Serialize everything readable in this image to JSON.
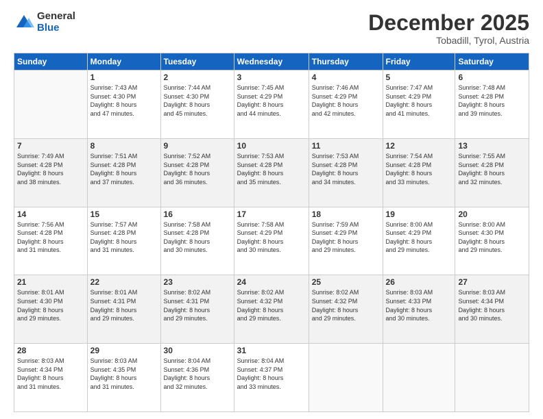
{
  "logo": {
    "general": "General",
    "blue": "Blue"
  },
  "header": {
    "month": "December 2025",
    "location": "Tobadill, Tyrol, Austria"
  },
  "weekdays": [
    "Sunday",
    "Monday",
    "Tuesday",
    "Wednesday",
    "Thursday",
    "Friday",
    "Saturday"
  ],
  "weeks": [
    [
      {
        "day": "",
        "sunrise": "",
        "sunset": "",
        "daylight": ""
      },
      {
        "day": "1",
        "sunrise": "Sunrise: 7:43 AM",
        "sunset": "Sunset: 4:30 PM",
        "daylight": "Daylight: 8 hours and 47 minutes."
      },
      {
        "day": "2",
        "sunrise": "Sunrise: 7:44 AM",
        "sunset": "Sunset: 4:30 PM",
        "daylight": "Daylight: 8 hours and 45 minutes."
      },
      {
        "day": "3",
        "sunrise": "Sunrise: 7:45 AM",
        "sunset": "Sunset: 4:29 PM",
        "daylight": "Daylight: 8 hours and 44 minutes."
      },
      {
        "day": "4",
        "sunrise": "Sunrise: 7:46 AM",
        "sunset": "Sunset: 4:29 PM",
        "daylight": "Daylight: 8 hours and 42 minutes."
      },
      {
        "day": "5",
        "sunrise": "Sunrise: 7:47 AM",
        "sunset": "Sunset: 4:29 PM",
        "daylight": "Daylight: 8 hours and 41 minutes."
      },
      {
        "day": "6",
        "sunrise": "Sunrise: 7:48 AM",
        "sunset": "Sunset: 4:28 PM",
        "daylight": "Daylight: 8 hours and 39 minutes."
      }
    ],
    [
      {
        "day": "7",
        "sunrise": "Sunrise: 7:49 AM",
        "sunset": "Sunset: 4:28 PM",
        "daylight": "Daylight: 8 hours and 38 minutes."
      },
      {
        "day": "8",
        "sunrise": "Sunrise: 7:51 AM",
        "sunset": "Sunset: 4:28 PM",
        "daylight": "Daylight: 8 hours and 37 minutes."
      },
      {
        "day": "9",
        "sunrise": "Sunrise: 7:52 AM",
        "sunset": "Sunset: 4:28 PM",
        "daylight": "Daylight: 8 hours and 36 minutes."
      },
      {
        "day": "10",
        "sunrise": "Sunrise: 7:53 AM",
        "sunset": "Sunset: 4:28 PM",
        "daylight": "Daylight: 8 hours and 35 minutes."
      },
      {
        "day": "11",
        "sunrise": "Sunrise: 7:53 AM",
        "sunset": "Sunset: 4:28 PM",
        "daylight": "Daylight: 8 hours and 34 minutes."
      },
      {
        "day": "12",
        "sunrise": "Sunrise: 7:54 AM",
        "sunset": "Sunset: 4:28 PM",
        "daylight": "Daylight: 8 hours and 33 minutes."
      },
      {
        "day": "13",
        "sunrise": "Sunrise: 7:55 AM",
        "sunset": "Sunset: 4:28 PM",
        "daylight": "Daylight: 8 hours and 32 minutes."
      }
    ],
    [
      {
        "day": "14",
        "sunrise": "Sunrise: 7:56 AM",
        "sunset": "Sunset: 4:28 PM",
        "daylight": "Daylight: 8 hours and 31 minutes."
      },
      {
        "day": "15",
        "sunrise": "Sunrise: 7:57 AM",
        "sunset": "Sunset: 4:28 PM",
        "daylight": "Daylight: 8 hours and 31 minutes."
      },
      {
        "day": "16",
        "sunrise": "Sunrise: 7:58 AM",
        "sunset": "Sunset: 4:28 PM",
        "daylight": "Daylight: 8 hours and 30 minutes."
      },
      {
        "day": "17",
        "sunrise": "Sunrise: 7:58 AM",
        "sunset": "Sunset: 4:29 PM",
        "daylight": "Daylight: 8 hours and 30 minutes."
      },
      {
        "day": "18",
        "sunrise": "Sunrise: 7:59 AM",
        "sunset": "Sunset: 4:29 PM",
        "daylight": "Daylight: 8 hours and 29 minutes."
      },
      {
        "day": "19",
        "sunrise": "Sunrise: 8:00 AM",
        "sunset": "Sunset: 4:29 PM",
        "daylight": "Daylight: 8 hours and 29 minutes."
      },
      {
        "day": "20",
        "sunrise": "Sunrise: 8:00 AM",
        "sunset": "Sunset: 4:30 PM",
        "daylight": "Daylight: 8 hours and 29 minutes."
      }
    ],
    [
      {
        "day": "21",
        "sunrise": "Sunrise: 8:01 AM",
        "sunset": "Sunset: 4:30 PM",
        "daylight": "Daylight: 8 hours and 29 minutes."
      },
      {
        "day": "22",
        "sunrise": "Sunrise: 8:01 AM",
        "sunset": "Sunset: 4:31 PM",
        "daylight": "Daylight: 8 hours and 29 minutes."
      },
      {
        "day": "23",
        "sunrise": "Sunrise: 8:02 AM",
        "sunset": "Sunset: 4:31 PM",
        "daylight": "Daylight: 8 hours and 29 minutes."
      },
      {
        "day": "24",
        "sunrise": "Sunrise: 8:02 AM",
        "sunset": "Sunset: 4:32 PM",
        "daylight": "Daylight: 8 hours and 29 minutes."
      },
      {
        "day": "25",
        "sunrise": "Sunrise: 8:02 AM",
        "sunset": "Sunset: 4:32 PM",
        "daylight": "Daylight: 8 hours and 29 minutes."
      },
      {
        "day": "26",
        "sunrise": "Sunrise: 8:03 AM",
        "sunset": "Sunset: 4:33 PM",
        "daylight": "Daylight: 8 hours and 30 minutes."
      },
      {
        "day": "27",
        "sunrise": "Sunrise: 8:03 AM",
        "sunset": "Sunset: 4:34 PM",
        "daylight": "Daylight: 8 hours and 30 minutes."
      }
    ],
    [
      {
        "day": "28",
        "sunrise": "Sunrise: 8:03 AM",
        "sunset": "Sunset: 4:34 PM",
        "daylight": "Daylight: 8 hours and 31 minutes."
      },
      {
        "day": "29",
        "sunrise": "Sunrise: 8:03 AM",
        "sunset": "Sunset: 4:35 PM",
        "daylight": "Daylight: 8 hours and 31 minutes."
      },
      {
        "day": "30",
        "sunrise": "Sunrise: 8:04 AM",
        "sunset": "Sunset: 4:36 PM",
        "daylight": "Daylight: 8 hours and 32 minutes."
      },
      {
        "day": "31",
        "sunrise": "Sunrise: 8:04 AM",
        "sunset": "Sunset: 4:37 PM",
        "daylight": "Daylight: 8 hours and 33 minutes."
      },
      {
        "day": "",
        "sunrise": "",
        "sunset": "",
        "daylight": ""
      },
      {
        "day": "",
        "sunrise": "",
        "sunset": "",
        "daylight": ""
      },
      {
        "day": "",
        "sunrise": "",
        "sunset": "",
        "daylight": ""
      }
    ]
  ]
}
